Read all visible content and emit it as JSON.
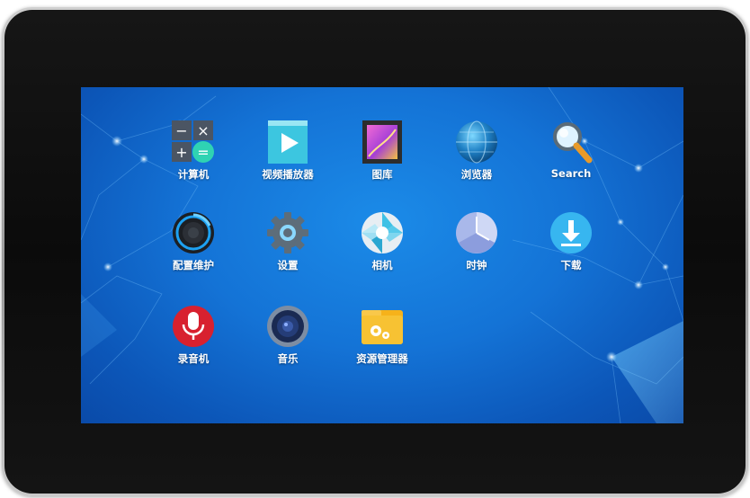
{
  "apps": [
    {
      "label": "计算机",
      "icon": "calculator-icon"
    },
    {
      "label": "视频播放器",
      "icon": "video-player-icon"
    },
    {
      "label": "图库",
      "icon": "gallery-icon"
    },
    {
      "label": "浏览器",
      "icon": "browser-globe-icon"
    },
    {
      "label": "Search",
      "icon": "search-icon"
    },
    {
      "label": "配置维护",
      "icon": "config-maintenance-icon"
    },
    {
      "label": "设置",
      "icon": "settings-gear-icon"
    },
    {
      "label": "相机",
      "icon": "camera-aperture-icon"
    },
    {
      "label": "时钟",
      "icon": "clock-icon"
    },
    {
      "label": "下载",
      "icon": "download-icon"
    },
    {
      "label": "录音机",
      "icon": "microphone-recorder-icon"
    },
    {
      "label": "音乐",
      "icon": "music-speaker-icon"
    },
    {
      "label": "资源管理器",
      "icon": "file-manager-folder-icon"
    }
  ],
  "colors": {
    "wallpaper": "#1473d6",
    "bezel": "#0f0f0f",
    "frame": "#b5b5b5"
  }
}
